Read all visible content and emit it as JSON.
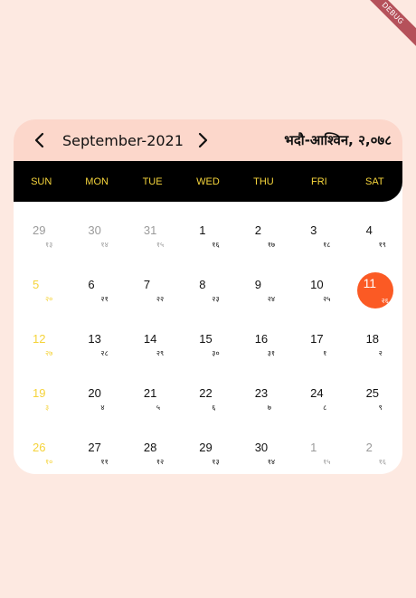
{
  "debug_banner": "DEBUG",
  "header": {
    "month_label": "September-2021",
    "bs_label": "भदौ-आश्विन, २,०७८",
    "prev_icon": "chevron-left-icon",
    "next_icon": "chevron-right-icon"
  },
  "colors": {
    "background": "#fde9e1",
    "header_bg": "#fcd7cb",
    "weekday_bar": "#000000",
    "weekday_text": "#f7d63c",
    "sunday_text": "#f5d33a",
    "muted_text": "#9a9a9a",
    "today_bg": "#fb5a24"
  },
  "weekdays": [
    "SUN",
    "MON",
    "TUE",
    "WED",
    "THU",
    "FRI",
    "SAT"
  ],
  "days": [
    {
      "day": "29",
      "np": "१३",
      "muted": true
    },
    {
      "day": "30",
      "np": "१४",
      "muted": true
    },
    {
      "day": "31",
      "np": "१५",
      "muted": true
    },
    {
      "day": "1",
      "np": "१६"
    },
    {
      "day": "2",
      "np": "१७"
    },
    {
      "day": "3",
      "np": "१८"
    },
    {
      "day": "4",
      "np": "१९"
    },
    {
      "day": "5",
      "np": "२०"
    },
    {
      "day": "6",
      "np": "२१"
    },
    {
      "day": "7",
      "np": "२२"
    },
    {
      "day": "8",
      "np": "२३"
    },
    {
      "day": "9",
      "np": "२४"
    },
    {
      "day": "10",
      "np": "२५"
    },
    {
      "day": "11",
      "np": "२६",
      "today": true
    },
    {
      "day": "12",
      "np": "२७"
    },
    {
      "day": "13",
      "np": "२८"
    },
    {
      "day": "14",
      "np": "२९"
    },
    {
      "day": "15",
      "np": "३०"
    },
    {
      "day": "16",
      "np": "३१"
    },
    {
      "day": "17",
      "np": "१"
    },
    {
      "day": "18",
      "np": "२"
    },
    {
      "day": "19",
      "np": "३"
    },
    {
      "day": "20",
      "np": "४"
    },
    {
      "day": "21",
      "np": "५"
    },
    {
      "day": "22",
      "np": "६"
    },
    {
      "day": "23",
      "np": "७"
    },
    {
      "day": "24",
      "np": "८"
    },
    {
      "day": "25",
      "np": "९"
    },
    {
      "day": "26",
      "np": "१०"
    },
    {
      "day": "27",
      "np": "११"
    },
    {
      "day": "28",
      "np": "१२"
    },
    {
      "day": "29",
      "np": "१३"
    },
    {
      "day": "30",
      "np": "१४"
    },
    {
      "day": "1",
      "np": "१५",
      "muted": true
    },
    {
      "day": "2",
      "np": "१६",
      "muted": true
    }
  ]
}
